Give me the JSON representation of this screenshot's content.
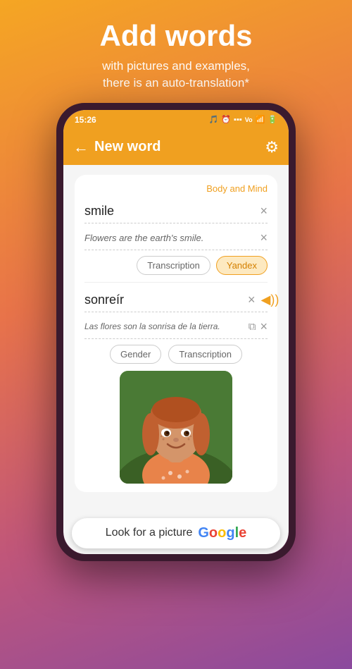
{
  "header": {
    "title": "Add words",
    "subtitle_line1": "with pictures and examples,",
    "subtitle_line2": "there is an auto-translation*"
  },
  "status_bar": {
    "time": "15:26",
    "icons": "🎵 ⏰ ▪▪▪ VoLTE WiFi 🔋"
  },
  "app_bar": {
    "title": "New word",
    "back_label": "←",
    "settings_label": "⚙"
  },
  "content": {
    "category": "Body and Mind",
    "word_field": {
      "value": "smile",
      "placeholder": "smile"
    },
    "example_field": {
      "value": "Flowers are the earth's smile.",
      "placeholder": ""
    },
    "buttons": {
      "transcription": "Transcription",
      "yandex": "Yandex"
    },
    "translation_section": {
      "word_field": {
        "value": "sonreír"
      },
      "example_field": {
        "value": "Las flores son la sonrisa de la tierra."
      },
      "buttons": {
        "gender": "Gender",
        "transcription": "Transcription"
      }
    }
  },
  "google_bar": {
    "text": "Look for a picture",
    "google": "Google"
  },
  "icons": {
    "back": "←",
    "close": "×",
    "settings": "⚙",
    "speaker": "◀))",
    "copy": "⧉"
  }
}
